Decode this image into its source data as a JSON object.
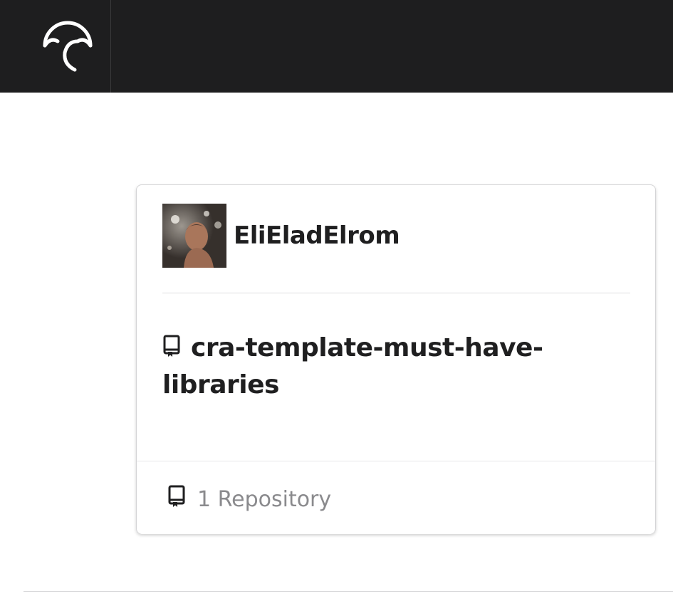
{
  "header": {
    "logo_icon": "umbrella-c-logo-icon",
    "background": "#1e1e1f"
  },
  "card": {
    "owner": {
      "name": "EliEladElrom",
      "avatar_icon": "user-avatar"
    },
    "repo": {
      "title": "cra-template-must-have-libraries",
      "icon": "repo-book-icon"
    },
    "footer": {
      "repo_count_label": "1 Repository",
      "icon": "repo-book-icon"
    }
  }
}
